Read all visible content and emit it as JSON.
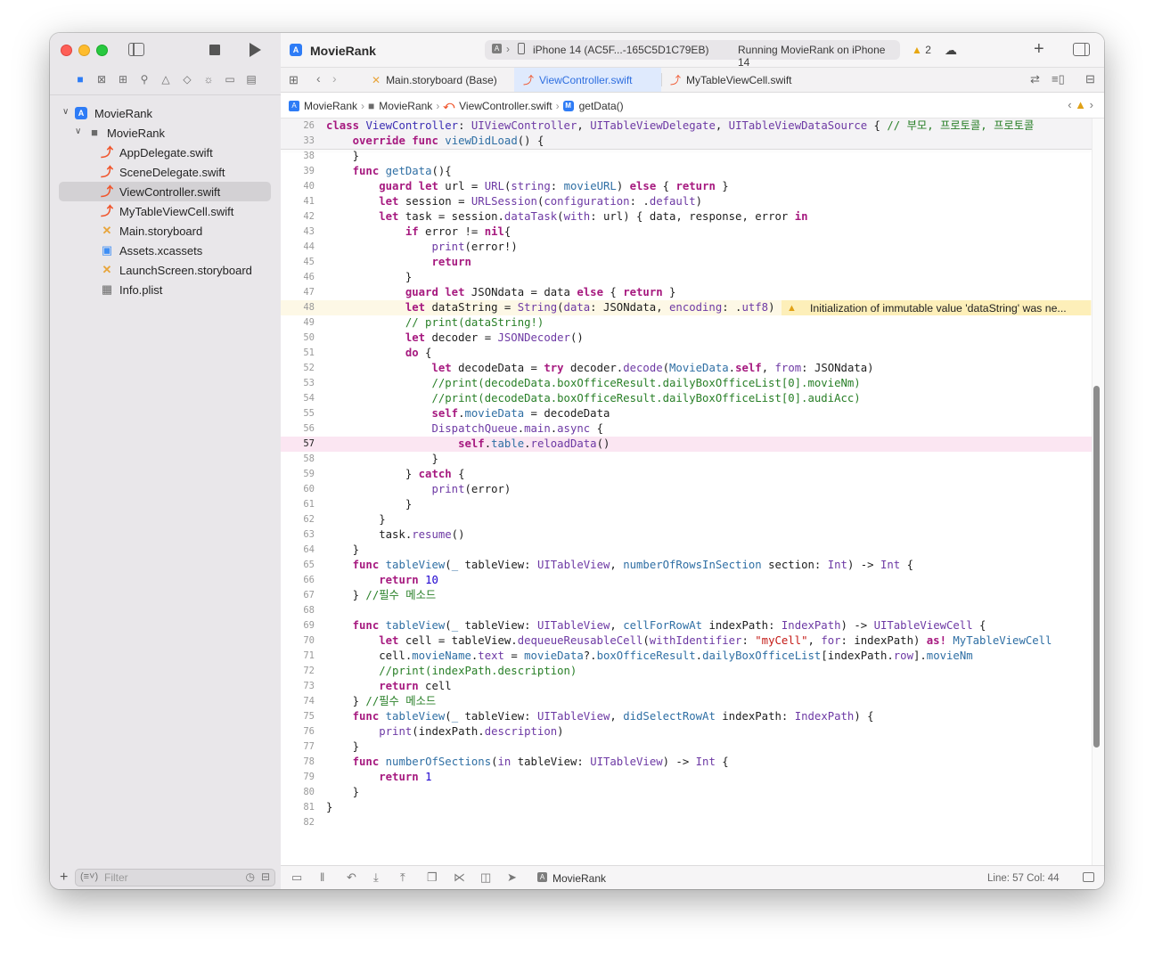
{
  "toolbar": {
    "project_title": "MovieRank",
    "destination": "iPhone 14 (AC5F...-165C5D1C79EB)",
    "status": "Running MovieRank on iPhone 14",
    "warning_count": "2"
  },
  "navigator_icons": [
    "folder-icon",
    "source-control-icon",
    "symbol-icon",
    "find-icon",
    "issue-icon",
    "test-icon",
    "debug-icon",
    "breakpoint-icon",
    "report-icon"
  ],
  "tree": [
    {
      "label": "MovieRank",
      "kind": "project",
      "indent": 0,
      "disclosure": "open"
    },
    {
      "label": "MovieRank",
      "kind": "folder",
      "indent": 1,
      "disclosure": "open"
    },
    {
      "label": "AppDelegate.swift",
      "kind": "swift",
      "indent": 2
    },
    {
      "label": "SceneDelegate.swift",
      "kind": "swift",
      "indent": 2
    },
    {
      "label": "ViewController.swift",
      "kind": "swift",
      "indent": 2,
      "selected": true
    },
    {
      "label": "MyTableViewCell.swift",
      "kind": "swift",
      "indent": 2
    },
    {
      "label": "Main.storyboard",
      "kind": "storyboard",
      "indent": 2
    },
    {
      "label": "Assets.xcassets",
      "kind": "assets",
      "indent": 2
    },
    {
      "label": "LaunchScreen.storyboard",
      "kind": "storyboard",
      "indent": 2
    },
    {
      "label": "Info.plist",
      "kind": "plist",
      "indent": 2
    }
  ],
  "filter": {
    "placeholder": "Filter"
  },
  "tabs": [
    {
      "label": "Main.storyboard (Base)",
      "kind": "storyboard"
    },
    {
      "label": "ViewController.swift",
      "kind": "swift",
      "active": true
    },
    {
      "label": "MyTableViewCell.swift",
      "kind": "swift"
    }
  ],
  "jumpbar": {
    "project": "MovieRank",
    "folder": "MovieRank",
    "file": "ViewController.swift",
    "symbol": "getData()"
  },
  "editor": {
    "warning_text": "Initialization of immutable value 'dataString' was ne...",
    "lines": [
      {
        "n": "26",
        "sticky": true,
        "html": "<span class=\"k\">class</span> <span class=\"t\">ViewController</span>: <span class=\"tp\">UIViewController</span>, <span class=\"tp\">UITableViewDelegate</span>, <span class=\"tp\">UITableViewDataSource</span> { <span class=\"c\">// 부모, 프로토콜, 프로토콜</span>"
      },
      {
        "n": "33",
        "sticky": true,
        "html": "    <span class=\"k\">override</span> <span class=\"k\">func</span> <span class=\"f\">viewDidLoad</span>() {"
      },
      {
        "n": "38",
        "html": "    }"
      },
      {
        "n": "39",
        "html": "    <span class=\"k\">func</span> <span class=\"f\">getData</span>(){"
      },
      {
        "n": "40",
        "html": "        <span class=\"k\">guard</span> <span class=\"k\">let</span> url = <span class=\"tp\">URL</span>(<span class=\"tp\">string</span>: <span class=\"f\">movieURL</span>) <span class=\"k\">else</span> { <span class=\"k\">return</span> }"
      },
      {
        "n": "41",
        "html": "        <span class=\"k\">let</span> session = <span class=\"tp\">URLSession</span>(<span class=\"tp\">configuration</span>: .<span class=\"tp\">default</span>)"
      },
      {
        "n": "42",
        "html": "        <span class=\"k\">let</span> task = session.<span class=\"tp\">dataTask</span>(<span class=\"tp\">with</span>: url) { data, response, error <span class=\"k\">in</span>"
      },
      {
        "n": "43",
        "html": "            <span class=\"k\">if</span> error != <span class=\"k\">nil</span>{"
      },
      {
        "n": "44",
        "html": "                <span class=\"tp\">print</span>(error!)"
      },
      {
        "n": "45",
        "html": "                <span class=\"k\">return</span>"
      },
      {
        "n": "46",
        "html": "            }"
      },
      {
        "n": "47",
        "html": "            <span class=\"k\">guard</span> <span class=\"k\">let</span> JSONdata = data <span class=\"k\">else</span> { <span class=\"k\">return</span> }"
      },
      {
        "n": "48",
        "warn": true,
        "html": "            <span class=\"k\">let</span> dataString = <span class=\"tp\">String</span>(<span class=\"tp\">data</span>: JSONdata, <span class=\"tp\">encoding</span>: .<span class=\"tp\">utf8</span>)"
      },
      {
        "n": "49",
        "html": "            <span class=\"c\">// print(dataString!)</span>"
      },
      {
        "n": "50",
        "html": "            <span class=\"k\">let</span> decoder = <span class=\"tp\">JSONDecoder</span>()"
      },
      {
        "n": "51",
        "html": "            <span class=\"k\">do</span> {"
      },
      {
        "n": "52",
        "html": "                <span class=\"k\">let</span> decodeData = <span class=\"k\">try</span> decoder.<span class=\"tp\">decode</span>(<span class=\"f\">MovieData</span>.<span class=\"k\">self</span>, <span class=\"tp\">from</span>: JSONdata)"
      },
      {
        "n": "53",
        "html": "                <span class=\"c\">//print(decodeData.boxOfficeResult.dailyBoxOfficeList[0].movieNm)</span>"
      },
      {
        "n": "54",
        "html": "                <span class=\"c\">//print(decodeData.boxOfficeResult.dailyBoxOfficeList[0].audiAcc)</span>"
      },
      {
        "n": "55",
        "html": "                <span class=\"k\">self</span>.<span class=\"f\">movieData</span> = decodeData"
      },
      {
        "n": "56",
        "html": "                <span class=\"tp\">DispatchQueue</span>.<span class=\"tp\">main</span>.<span class=\"tp\">async</span> {"
      },
      {
        "n": "57",
        "current": true,
        "html": "                    <span class=\"k\">self</span>.<span class=\"f\">table</span>.<span class=\"tp\">reloadData</span>()"
      },
      {
        "n": "58",
        "html": "                }"
      },
      {
        "n": "59",
        "html": "            } <span class=\"k\">catch</span> {"
      },
      {
        "n": "60",
        "html": "                <span class=\"tp\">print</span>(error)"
      },
      {
        "n": "61",
        "html": "            }"
      },
      {
        "n": "62",
        "html": "        }"
      },
      {
        "n": "63",
        "html": "        task.<span class=\"tp\">resume</span>()"
      },
      {
        "n": "64",
        "html": "    }"
      },
      {
        "n": "65",
        "html": "    <span class=\"k\">func</span> <span class=\"f\">tableView</span>(<span class=\"f\">_</span> tableView: <span class=\"tp\">UITableView</span>, <span class=\"f\">numberOfRowsInSection</span> section: <span class=\"tp\">Int</span>) -> <span class=\"tp\">Int</span> {"
      },
      {
        "n": "66",
        "html": "        <span class=\"k\">return</span> <span class=\"n\">10</span>"
      },
      {
        "n": "67",
        "html": "    } <span class=\"c\">//필수 메소드</span>"
      },
      {
        "n": "68",
        "html": ""
      },
      {
        "n": "69",
        "html": "    <span class=\"k\">func</span> <span class=\"f\">tableView</span>(<span class=\"f\">_</span> tableView: <span class=\"tp\">UITableView</span>, <span class=\"f\">cellForRowAt</span> indexPath: <span class=\"tp\">IndexPath</span>) -> <span class=\"tp\">UITableViewCell</span> {"
      },
      {
        "n": "70",
        "html": "        <span class=\"k\">let</span> cell = tableView.<span class=\"tp\">dequeueReusableCell</span>(<span class=\"tp\">withIdentifier</span>: <span class=\"s\">\"myCell\"</span>, <span class=\"tp\">for</span>: indexPath) <span class=\"k\">as!</span> <span class=\"f\">MyTableViewCell</span>"
      },
      {
        "n": "71",
        "html": "        cell.<span class=\"f\">movieName</span>.<span class=\"tp\">text</span> = <span class=\"f\">movieData</span>?.<span class=\"f\">boxOfficeResult</span>.<span class=\"f\">dailyBoxOfficeList</span>[indexPath.<span class=\"tp\">row</span>].<span class=\"f\">movieNm</span>"
      },
      {
        "n": "72",
        "html": "        <span class=\"c\">//print(indexPath.description)</span>"
      },
      {
        "n": "73",
        "html": "        <span class=\"k\">return</span> cell"
      },
      {
        "n": "74",
        "html": "    } <span class=\"c\">//필수 메소드</span>"
      },
      {
        "n": "75",
        "html": "    <span class=\"k\">func</span> <span class=\"f\">tableView</span>(<span class=\"f\">_</span> tableView: <span class=\"tp\">UITableView</span>, <span class=\"f\">didSelectRowAt</span> indexPath: <span class=\"tp\">IndexPath</span>) {"
      },
      {
        "n": "76",
        "html": "        <span class=\"tp\">print</span>(indexPath.<span class=\"tp\">description</span>)"
      },
      {
        "n": "77",
        "html": "    }"
      },
      {
        "n": "78",
        "html": "    <span class=\"k\">func</span> <span class=\"f\">numberOfSections</span>(<span class=\"tp\">in</span> tableView: <span class=\"tp\">UITableView</span>) -> <span class=\"tp\">Int</span> {"
      },
      {
        "n": "79",
        "html": "        <span class=\"k\">return</span> <span class=\"n\">1</span>"
      },
      {
        "n": "80",
        "html": "    }"
      },
      {
        "n": "81",
        "html": "}"
      },
      {
        "n": "82",
        "html": ""
      }
    ]
  },
  "statusbar": {
    "scheme": "MovieRank",
    "position": "Line: 57  Col: 44"
  }
}
